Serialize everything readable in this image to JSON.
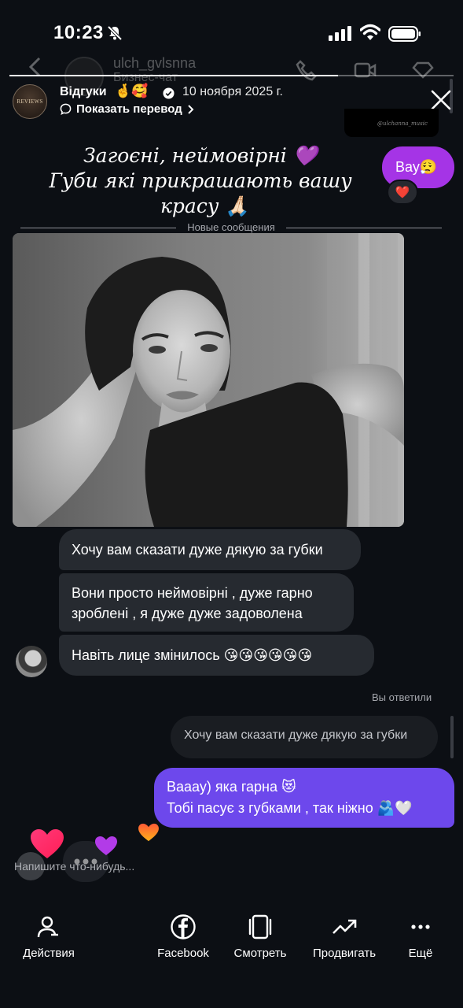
{
  "status_bar": {
    "time": "10:23"
  },
  "underlying_chat": {
    "username": "ulch_gvlsnna",
    "subtitle": "Бизнес-чат"
  },
  "story": {
    "progress_fraction": 0.74,
    "account_name": "Відгуки",
    "name_emoji": "🤞🥰",
    "date": "10 ноября 2025 г.",
    "show_translation": "Показать перевод",
    "avatar_text": "REVIEWS",
    "thumbnail_text": "@ulchanna_music"
  },
  "caption": {
    "line1": "Загоєні, неймовірні 💜",
    "line2": "Губи які прикрашають вашу",
    "line3": "красу 🙏🏻"
  },
  "chat": {
    "wow_message": "Вау😮‍💨",
    "wow_reaction": "❤️",
    "new_messages_divider": "Новые сообщения",
    "messages": [
      {
        "text": "Хочу вам сказати дуже дякую за губки"
      },
      {
        "text": "Вони просто неймовірні , дуже гарно зроблені , я дуже дуже задоволена"
      },
      {
        "text": "Навіть лице змінилось 😘😘😘😘😘😘"
      }
    ],
    "replied_label": "Вы ответили",
    "quoted_text": "Хочу вам сказати дуже дякую за губки",
    "reply_line1": "Вааау) яка гарна 😻",
    "reply_line2": "Тобі пасує з губками , так ніжно 🫂🤍",
    "input_placeholder": "Напишите что-нибудь..."
  },
  "bottom_bar": {
    "tabs": [
      {
        "label": "Действия",
        "icon": "actions-icon"
      },
      {
        "label": "Facebook",
        "icon": "facebook-icon"
      },
      {
        "label": "Смотреть",
        "icon": "watch-icon"
      },
      {
        "label": "Продвигать",
        "icon": "promote-icon"
      },
      {
        "label": "Ещё",
        "icon": "more-icon"
      }
    ]
  },
  "colors": {
    "background": "#0c0f14",
    "incoming_bubble": "#262a30",
    "outgoing_bubble": "#6d48ec",
    "wow_bubble": "#a534e6"
  }
}
